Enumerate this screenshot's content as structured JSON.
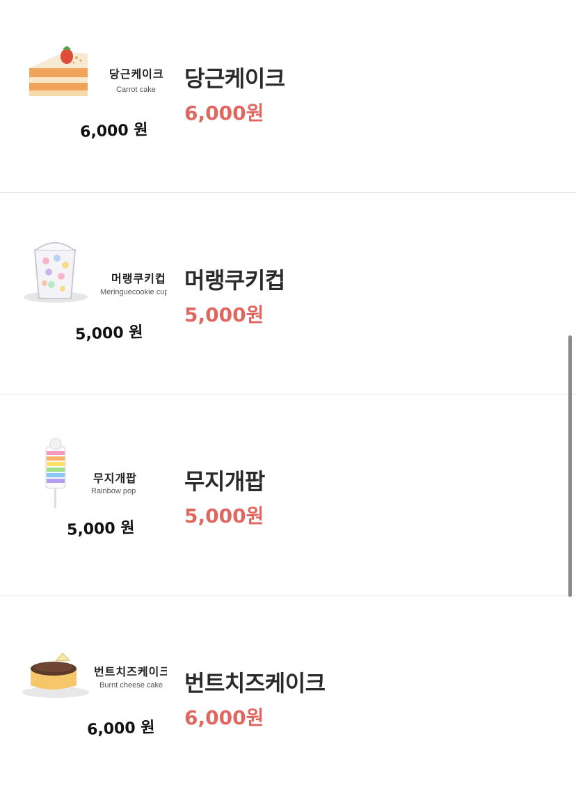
{
  "items": [
    {
      "name": "당근케이크",
      "price": "6,000원",
      "thumb": {
        "name_kr": "당근케이크",
        "name_en": "Carrot cake",
        "price": "6,000 원",
        "image_icon": "carrot-cake-slice"
      }
    },
    {
      "name": "머랭쿠키컵",
      "price": "5,000원",
      "thumb": {
        "name_kr": "머랭쿠키컵",
        "name_en": "Meringuecookie cup",
        "price": "5,000 원",
        "image_icon": "meringue-cookie-cup"
      }
    },
    {
      "name": "무지개팝",
      "price": "5,000원",
      "thumb": {
        "name_kr": "무지개팝",
        "name_en": "Rainbow pop",
        "price": "5,000 원",
        "image_icon": "rainbow-pop"
      }
    },
    {
      "name": "번트치즈케이크",
      "price": "6,000원",
      "thumb": {
        "name_kr": "번트치즈케이크",
        "name_en": "Burnt cheese cake",
        "price": "6,000 원",
        "image_icon": "burnt-cheese-cake"
      }
    }
  ],
  "colors": {
    "price": "#e06760",
    "name": "#2a2a2a",
    "divider": "#e4e4e4",
    "scrollbar": "#8a8a8a"
  }
}
